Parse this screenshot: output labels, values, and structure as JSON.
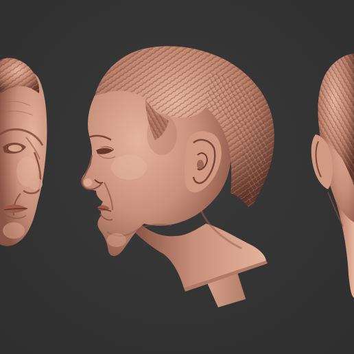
{
  "scene": {
    "background_color": "#2f2f2f",
    "background_light": "#3a3a3a",
    "clay_base": "#c8907a",
    "clay_light": "#e6b39c",
    "clay_shadow": "#8a5444",
    "clay_deep": "#5e3429",
    "hair_color": "#b27862",
    "views": [
      {
        "name": "front-three-quarter",
        "label": ""
      },
      {
        "name": "left-profile",
        "label": ""
      },
      {
        "name": "back-three-quarter",
        "label": ""
      }
    ]
  }
}
